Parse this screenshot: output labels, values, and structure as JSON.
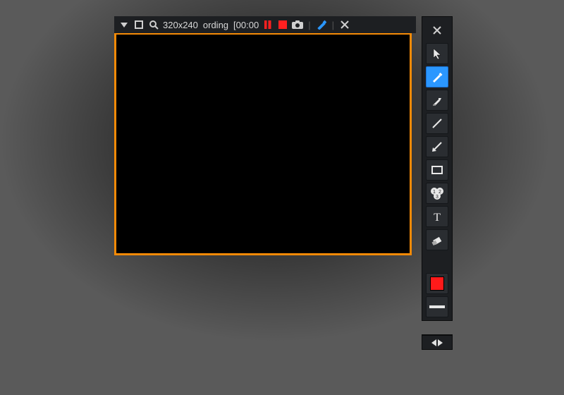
{
  "topbar": {
    "resolution": "320x240",
    "status_fragment": "ording",
    "time": "[00:00"
  },
  "tools": {
    "close": "close",
    "cursor": "cursor",
    "pencil": "pencil",
    "marker": "marker",
    "line": "line",
    "arrow": "arrow",
    "rectangle": "rectangle",
    "step": "numbered-step",
    "text": "text",
    "eraser": "eraser"
  },
  "colors": {
    "accent_border": "#f58a07",
    "selected_tool": "#2b97ff",
    "swatch": "#ff1a1a",
    "record_red": "#ff2020"
  }
}
